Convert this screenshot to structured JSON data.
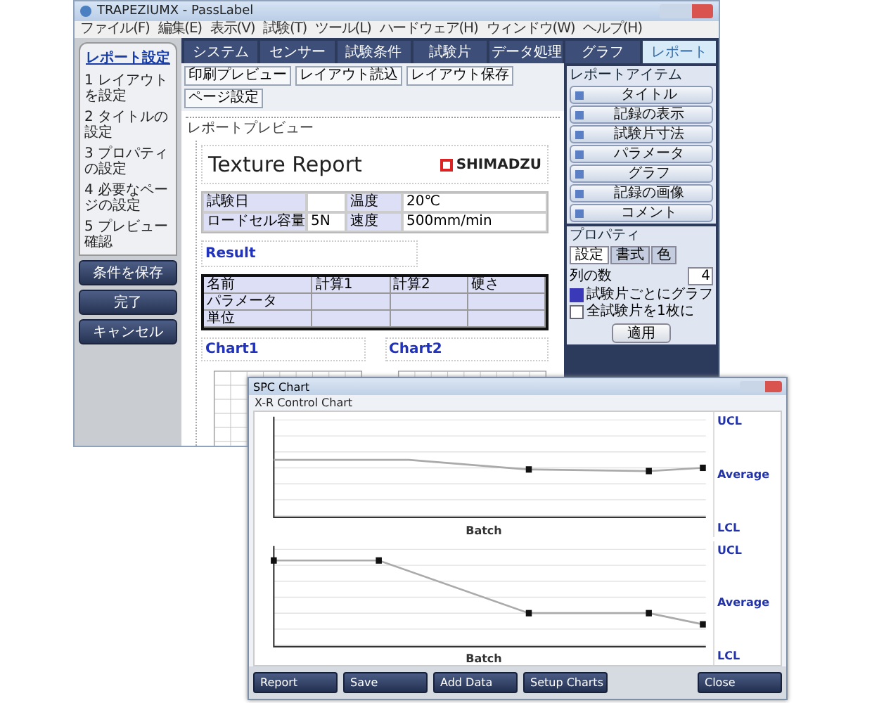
{
  "report_window": {
    "title": "TRAPEZIUMX - PassLabel",
    "menu": [
      "ファイル(F)",
      "編集(E)",
      "表示(V)",
      "試験(T)",
      "ツール(L)",
      "ハードウェア(H)",
      "ウィンドウ(W)",
      "ヘルプ(H)"
    ],
    "tabs": [
      {
        "label": "システム",
        "selected": false
      },
      {
        "label": "センサー",
        "selected": false
      },
      {
        "label": "試験条件",
        "selected": false
      },
      {
        "label": "試験片",
        "selected": false
      },
      {
        "label": "データ処理",
        "selected": false
      },
      {
        "label": "グラフ",
        "selected": false
      },
      {
        "label": "レポート",
        "selected": true
      }
    ],
    "wizard": {
      "title": "レポート設定",
      "steps": [
        "1 レイアウトを設定",
        "2 タイトルの設定",
        "3 プロパティの設定",
        "4 必要なページの設定",
        "5 プレビュー確認"
      ],
      "buttons": [
        "条件を保存",
        "完了",
        "キャンセル"
      ]
    },
    "toolbar": [
      "印刷プレビュー",
      "レイアウト読込",
      "レイアウト保存",
      "ページ設定"
    ],
    "preview_label": "レポートプレビュー",
    "report": {
      "title": "Texture Report",
      "logo": "SHIMADZU",
      "fields": [
        {
          "label": "試験日"
        },
        {
          "label": "温度",
          "value": "20℃"
        },
        {
          "label": "ロードセル容量",
          "value": "5N"
        },
        {
          "label": "速度",
          "value": "500mm/min"
        }
      ],
      "result_label": "Result",
      "result_columns": [
        "名前",
        "計算1",
        "計算2",
        "硬さ"
      ],
      "result_rows": [
        [
          "パラメータ"
        ],
        [
          "単位"
        ]
      ],
      "chart_labels": [
        "Chart1",
        "Chart2"
      ]
    },
    "items_panel": {
      "title": "レポートアイテム",
      "items": [
        "タイトル",
        "記録の表示",
        "試験片寸法",
        "パラメータ",
        "グラフ",
        "記録の画像",
        "コメント"
      ]
    },
    "properties": {
      "title": "プロパティ",
      "tabs": [
        {
          "label": "設定",
          "selected": true
        },
        {
          "label": "書式",
          "selected": false
        },
        {
          "label": "色",
          "selected": false
        }
      ],
      "columns_label": "列の数",
      "columns_value": "4",
      "options": [
        {
          "label": "試験片ごとにグラフ",
          "checked": true
        },
        {
          "label": "全試験片を1枚に",
          "checked": false
        }
      ],
      "apply": "適用"
    }
  },
  "spc_window": {
    "title": "SPC Chart",
    "chart_title": "X-R Control Chart",
    "charts": [
      {
        "xlabel": "Batch",
        "limits": [
          "UCL",
          "Average",
          "LCL"
        ]
      },
      {
        "xlabel": "Batch",
        "limits": [
          "UCL",
          "Average",
          "LCL"
        ]
      }
    ],
    "buttons": [
      "Report",
      "Save",
      "Add Data",
      "Setup Charts"
    ],
    "close": "Close"
  }
}
